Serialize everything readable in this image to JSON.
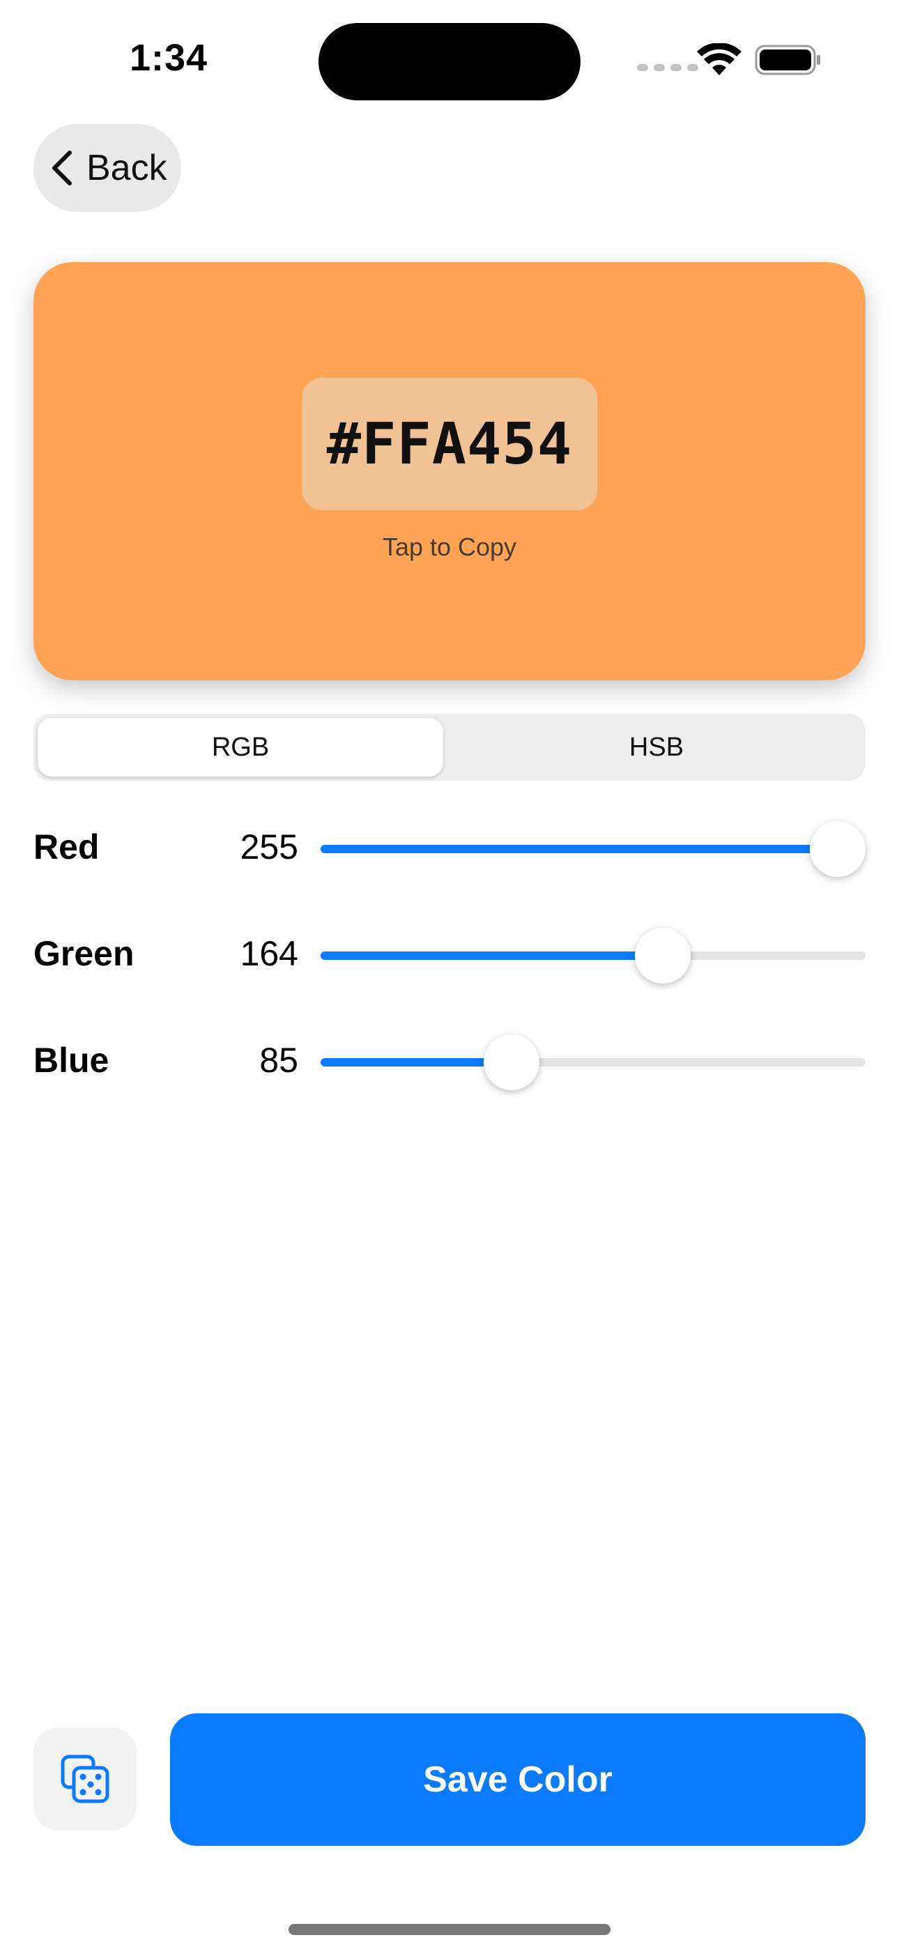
{
  "status_bar": {
    "time": "1:34"
  },
  "nav": {
    "back_label": "Back",
    "back_icon": "chevron-left-icon"
  },
  "preview": {
    "hex": "#FFA454",
    "hint": "Tap to Copy",
    "color": "#FFA454"
  },
  "mode": {
    "options": [
      "RGB",
      "HSB"
    ],
    "selected": "RGB"
  },
  "sliders": [
    {
      "label": "Red",
      "value": 255,
      "min": 0,
      "max": 255
    },
    {
      "label": "Green",
      "value": 164,
      "min": 0,
      "max": 255
    },
    {
      "label": "Blue",
      "value": 85,
      "min": 0,
      "max": 255
    }
  ],
  "actions": {
    "random_icon": "dice-icon",
    "save_label": "Save Color"
  },
  "colors": {
    "accent": "#0A7BFF",
    "segment_bg": "#EEEEEF",
    "track_bg": "#E3E3E5"
  }
}
